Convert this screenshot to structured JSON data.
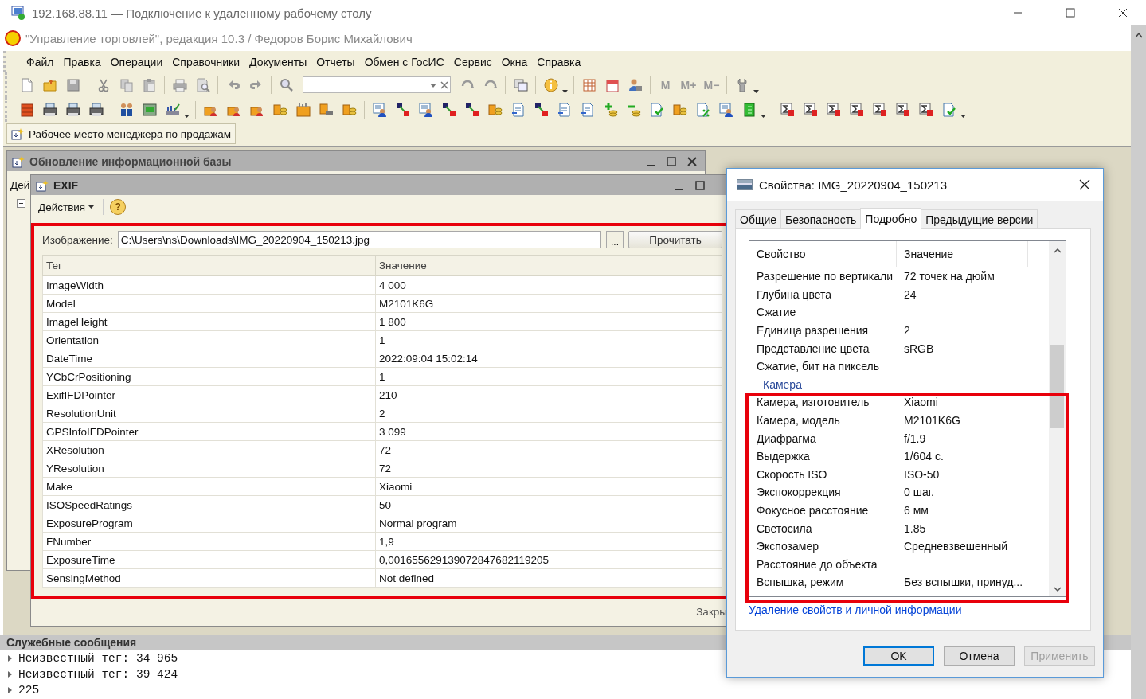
{
  "rdp_window": {
    "title": "192.168.88.11 — Подключение к удаленному рабочему столу"
  },
  "app": {
    "title": "\"Управление торговлей\", редакция 10.3 / Федоров Борис Михайлович",
    "menu": [
      "Файл",
      "Правка",
      "Операции",
      "Справочники",
      "Документы",
      "Отчеты",
      "Обмен с ГосИС",
      "Сервис",
      "Окна",
      "Справка"
    ],
    "memory_buttons": [
      "M",
      "M+",
      "M−"
    ],
    "panel_button": "Рабочее место менеджера по продажам"
  },
  "update_window": {
    "title": "Обновление информационной базы",
    "partial_label": "Дей"
  },
  "exif_window": {
    "title": "EXIF",
    "actions": "Действия",
    "help": "?",
    "image_label": "Изображение:",
    "image_path": "C:\\Users\\ns\\Downloads\\IMG_20220904_150213.jpg",
    "browse": "...",
    "read_button": "Прочитать",
    "columns": [
      "Тег",
      "Значение"
    ],
    "rows": [
      [
        "ImageWidth",
        "4 000"
      ],
      [
        "Model",
        "M2101K6G"
      ],
      [
        "ImageHeight",
        "1 800"
      ],
      [
        "Orientation",
        "1"
      ],
      [
        "DateTime",
        "2022:09:04 15:02:14"
      ],
      [
        "YCbCrPositioning",
        "1"
      ],
      [
        "ExifIFDPointer",
        "210"
      ],
      [
        "ResolutionUnit",
        "2"
      ],
      [
        "GPSInfoIFDPointer",
        "3 099"
      ],
      [
        "XResolution",
        "72"
      ],
      [
        "YResolution",
        "72"
      ],
      [
        "Make",
        "Xiaomi"
      ],
      [
        "ISOSpeedRatings",
        "50"
      ],
      [
        "ExposureProgram",
        "Normal program"
      ],
      [
        "FNumber",
        "1,9"
      ],
      [
        "ExposureTime",
        "0,001655629139072847682119205"
      ],
      [
        "SensingMethod",
        "Not defined"
      ]
    ],
    "close_partial": "Закры"
  },
  "messages": {
    "title": "Служебные сообщения",
    "lines": [
      "Неизвестный тег: 34 965",
      "Неизвестный тег: 39 424",
      "225"
    ]
  },
  "properties_dialog": {
    "title": "Свойства: IMG_20220904_150213",
    "tabs": [
      {
        "label": "Общие",
        "selected": false
      },
      {
        "label": "Безопасность",
        "selected": false
      },
      {
        "label": "Подробно",
        "selected": true
      },
      {
        "label": "Предыдущие версии",
        "selected": false
      }
    ],
    "columns": [
      "Свойство",
      "Значение"
    ],
    "rows": [
      {
        "kind": "property",
        "name": "Разрешение по вертикали",
        "value": "72 точек на дюйм"
      },
      {
        "kind": "property",
        "name": "Глубина цвета",
        "value": "24"
      },
      {
        "kind": "property",
        "name": "Сжатие"
      },
      {
        "kind": "property",
        "name": "Единица разрешения",
        "value": "2"
      },
      {
        "kind": "property",
        "name": "Представление цвета",
        "value": "sRGB"
      },
      {
        "kind": "property",
        "name": "Сжатие, бит на пиксель"
      },
      {
        "kind": "group",
        "name": "Камера"
      },
      {
        "kind": "property",
        "name": "Камера, изготовитель",
        "value": "Xiaomi"
      },
      {
        "kind": "property",
        "name": "Камера, модель",
        "value": "M2101K6G"
      },
      {
        "kind": "property",
        "name": "Диафрагма",
        "value": "f/1.9"
      },
      {
        "kind": "property",
        "name": "Выдержка",
        "value": "1/604 с."
      },
      {
        "kind": "property",
        "name": "Скорость ISO",
        "value": "ISO-50"
      },
      {
        "kind": "property",
        "name": "Экспокоррекция",
        "value": "0 шаг."
      },
      {
        "kind": "property",
        "name": "Фокусное расстояние",
        "value": "6 мм"
      },
      {
        "kind": "property",
        "name": "Светосила",
        "value": "1.85"
      },
      {
        "kind": "property",
        "name": "Экспозамер",
        "value": "Средневзвешенный"
      },
      {
        "kind": "property",
        "name": "Расстояние до объекта"
      },
      {
        "kind": "property",
        "name": "Вспышка, режим",
        "value": "Без вспышки, принуд..."
      }
    ],
    "link": "Удаление свойств и личной информации",
    "buttons": [
      {
        "label": "OK",
        "kind": "default",
        "disabled": false
      },
      {
        "label": "Отмена",
        "kind": "normal",
        "disabled": false
      },
      {
        "label": "Применить",
        "kind": "normal",
        "disabled": true
      }
    ]
  }
}
